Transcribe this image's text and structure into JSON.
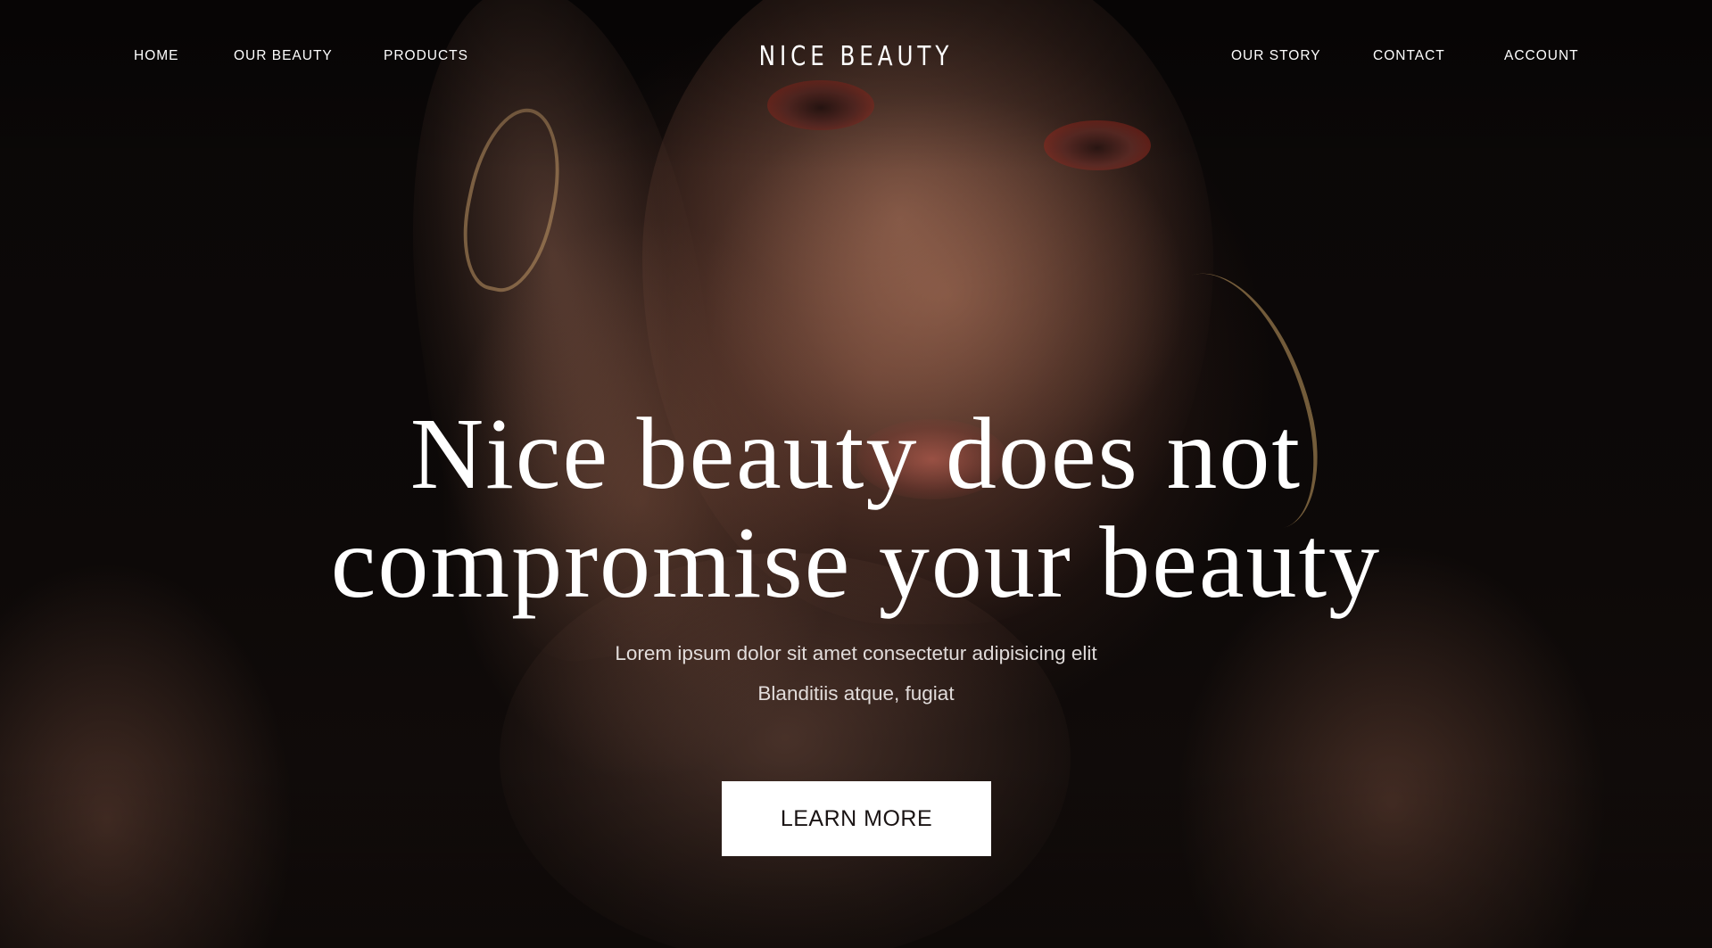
{
  "nav": {
    "left_links": [
      "HOME",
      "OUR BEAUTY",
      "PRODUCTS"
    ],
    "right_links": [
      "OUR STORY",
      "CONTACT",
      "ACCOUNT"
    ],
    "brand": "NICE BEAUTY"
  },
  "hero": {
    "headline_line1": "Nice beauty does not",
    "headline_line2": "compromise your beauty",
    "subtext_line1": "Lorem ipsum dolor sit amet consectetur adipisicing elit",
    "subtext_line2": "Blanditiis atque, fugiat",
    "cta_label": "LEARN MORE"
  },
  "colors": {
    "text": "#ffffff",
    "button_bg": "#ffffff",
    "button_text": "#1a1414",
    "background": "#050404"
  }
}
